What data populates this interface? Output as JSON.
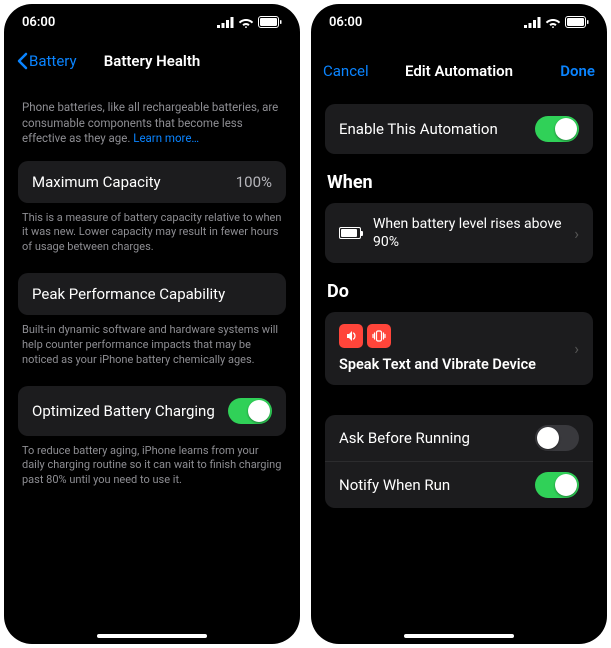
{
  "time": "06:00",
  "left": {
    "back_label": "Battery",
    "title": "Battery Health",
    "intro": "Phone batteries, like all rechargeable batteries, are consumable components that become less effective as they age.",
    "learn_more": "Learn more…",
    "max_capacity_label": "Maximum Capacity",
    "max_capacity_value": "100%",
    "max_capacity_footer": "This is a measure of battery capacity relative to when it was new. Lower capacity may result in fewer hours of usage between charges.",
    "peak_label": "Peak Performance Capability",
    "peak_footer": "Built-in dynamic software and hardware systems will help counter performance impacts that may be noticed as your iPhone battery chemically ages.",
    "optimized_label": "Optimized Battery Charging",
    "optimized_footer": "To reduce battery aging, iPhone learns from your daily charging routine so it can wait to finish charging past 80% until you need to use it."
  },
  "right": {
    "cancel": "Cancel",
    "title": "Edit Automation",
    "done": "Done",
    "enable_label": "Enable This Automation",
    "when_heading": "When",
    "when_text": "When battery level rises above 90%",
    "do_heading": "Do",
    "do_action": "Speak Text and Vibrate Device",
    "ask_label": "Ask Before Running",
    "notify_label": "Notify When Run"
  }
}
